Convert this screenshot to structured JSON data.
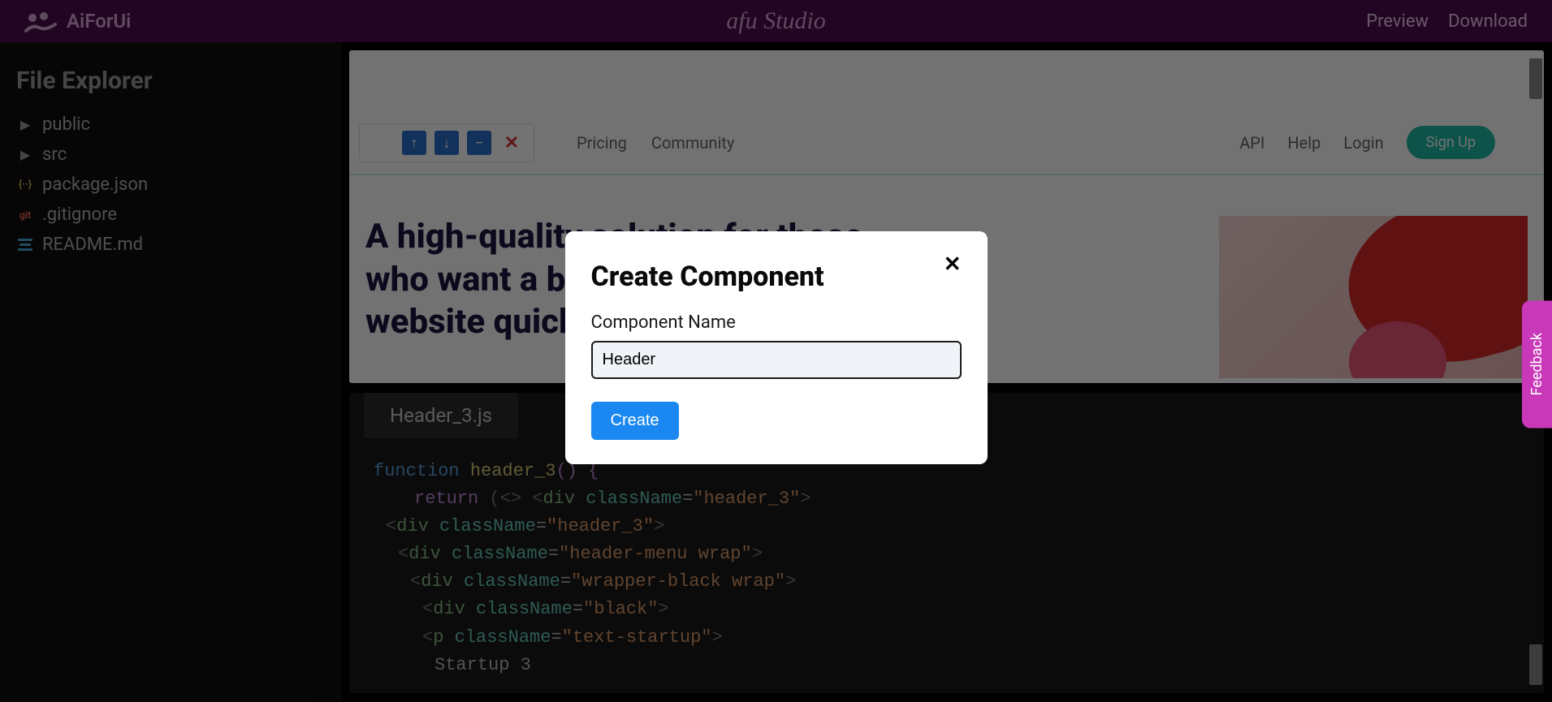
{
  "topbar": {
    "brand": "AiForUi",
    "centerTitle": "afu Studio",
    "links": {
      "preview": "Preview",
      "download": "Download"
    }
  },
  "sidebar": {
    "title": "File Explorer",
    "items": [
      {
        "name": "public",
        "icon": "chevron"
      },
      {
        "name": "src",
        "icon": "chevron"
      },
      {
        "name": "package.json",
        "icon": "json"
      },
      {
        "name": ".gitignore",
        "icon": "git"
      },
      {
        "name": "README.md",
        "icon": "md"
      }
    ]
  },
  "preview": {
    "nav": {
      "left": [
        "Pricing",
        "Community"
      ],
      "right": [
        "API",
        "Help",
        "Login"
      ],
      "signup": "Sign Up"
    },
    "hero": "A high-quality solution for those who want a beautiful startup website quickly."
  },
  "code": {
    "tab": "Header_3.js",
    "lines": {
      "l1a": "function",
      "l1b": "header_3",
      "l1c": "() {",
      "l2a": "return",
      "l2b": "(<> <",
      "l2c": "div",
      "l2d": "className",
      "l2e": "=",
      "l2f": "\"header_3\"",
      "l2g": ">",
      "l3a": "<",
      "l3b": "div",
      "l3c": "className",
      "l3d": "=",
      "l3e": "\"header_3\"",
      "l3f": ">",
      "l4a": "<",
      "l4b": "div",
      "l4c": "className",
      "l4d": "=",
      "l4e": "\"header-menu wrap\"",
      "l4f": ">",
      "l5a": "<",
      "l5b": "div",
      "l5c": "className",
      "l5d": "=",
      "l5e": "\"wrapper-black wrap\"",
      "l5f": ">",
      "l6a": "<",
      "l6b": "div",
      "l6c": "className",
      "l6d": "=",
      "l6e": "\"black\"",
      "l6f": ">",
      "l7a": "<",
      "l7b": "p",
      "l7c": "className",
      "l7d": "=",
      "l7e": "\"text-startup\"",
      "l7f": ">",
      "l8": "Startup 3"
    }
  },
  "modal": {
    "title": "Create Component",
    "label": "Component Name",
    "inputValue": "Header",
    "button": "Create"
  },
  "feedback": "Feedback"
}
